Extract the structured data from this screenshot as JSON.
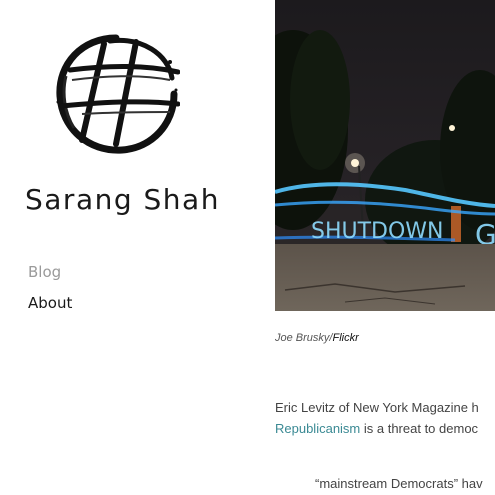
{
  "site": {
    "name": "Sarang Shah",
    "logo_icon": "ink-circle-hash-logo-icon"
  },
  "nav": {
    "items": [
      {
        "label": "Blog",
        "state": "active"
      },
      {
        "label": "About",
        "state": "normal"
      }
    ]
  },
  "post": {
    "hero_image_icon": "night-light-painting-photo",
    "caption": {
      "author": "Joe Brusky/",
      "source": "Flickr"
    },
    "paragraph": {
      "line1": "Eric Levitz of New York Magazine h",
      "line2_link": "Republicanism",
      "line2_rest": " is a threat to democ"
    },
    "quote_line": "“mainstream Democrats” hav"
  },
  "colors": {
    "link": "#3b8a94",
    "nav_active": "#9a9a9a",
    "light_text": "#2f7fff"
  }
}
